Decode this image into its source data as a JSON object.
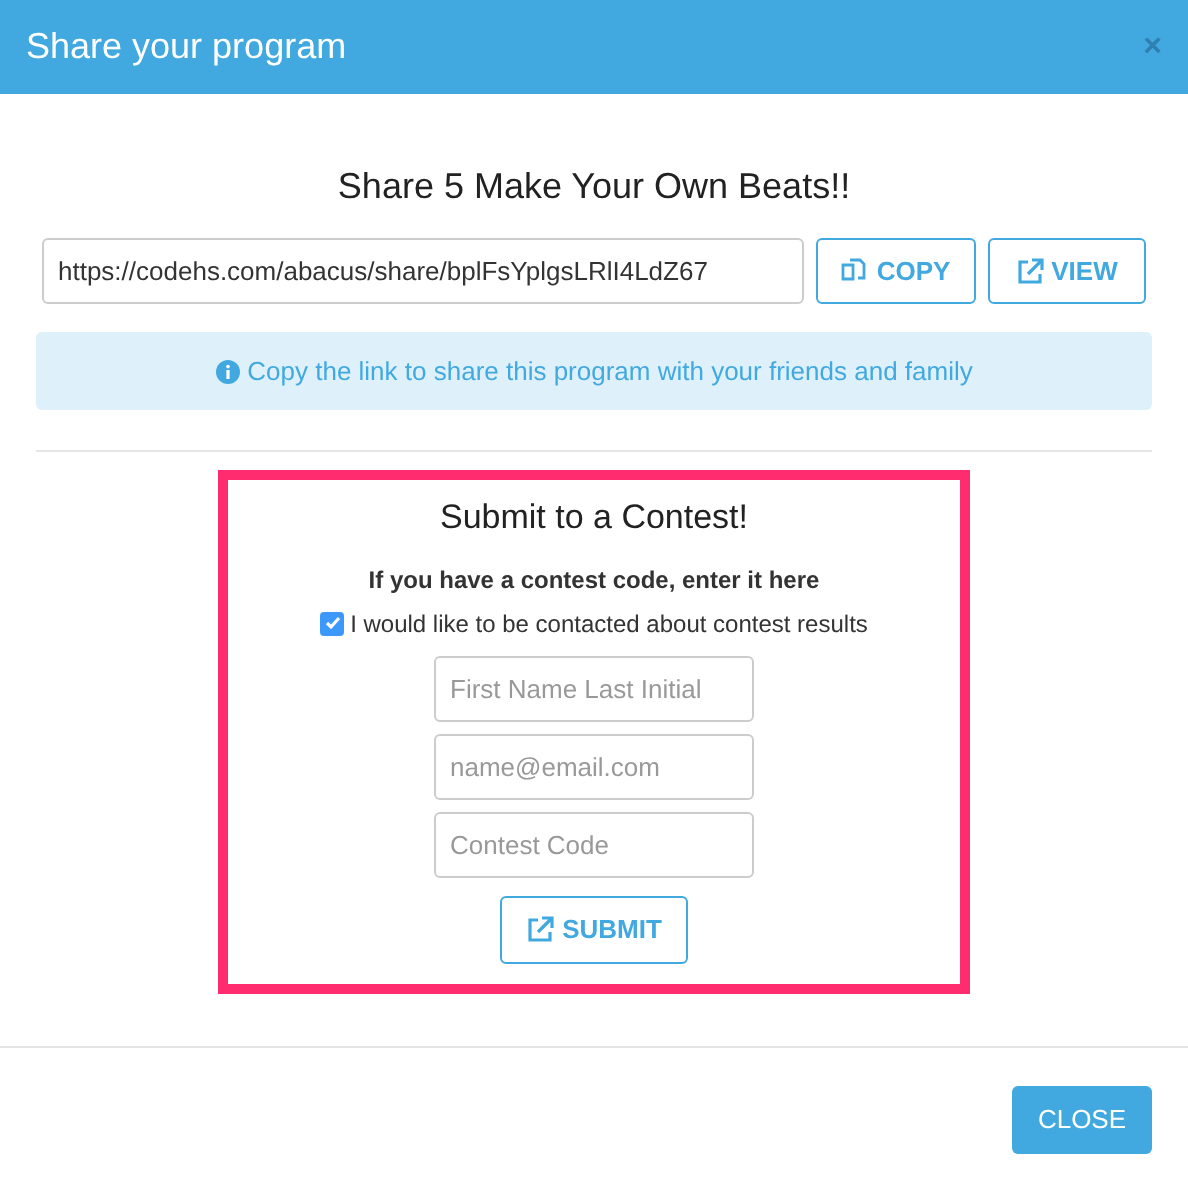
{
  "window": {
    "title": "Share your program",
    "close": "×"
  },
  "share": {
    "heading": "Share 5 Make Your Own Beats!!",
    "url": "https://codehs.com/abacus/share/bplFsYplgsLRlI4LdZ67",
    "buttons": [
      {
        "kind": "copy",
        "label": "COPY"
      },
      {
        "kind": "view",
        "label": "VIEW"
      }
    ],
    "info": "Copy the link to share this program with your friends and family"
  },
  "contest": {
    "title": "Submit to a Contest!",
    "subtitle": "If you have a contest code, enter it here",
    "contact": {
      "label": "I would like to be contacted about contest results",
      "checked": true
    },
    "fields": [
      {
        "placeholder": "First Name Last Initial"
      },
      {
        "placeholder": "name@email.com"
      },
      {
        "placeholder": "Contest Code"
      }
    ],
    "submit": "SUBMIT"
  },
  "footer": {
    "button": "CLOSE"
  }
}
